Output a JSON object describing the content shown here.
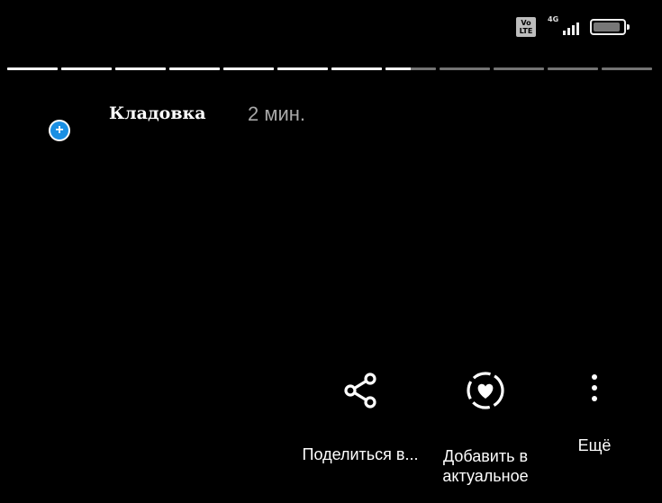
{
  "status_bar": {
    "volte_label": "Vo\nLTE",
    "network_label": "4G",
    "signal_bars": 4,
    "battery_level": 0.9
  },
  "story": {
    "segments_total": 12,
    "segments_seen": 7,
    "current_segment_progress": 0.5
  },
  "header": {
    "username": "Кладовка",
    "timestamp": "2 мин."
  },
  "actions": {
    "share_label": "Поделиться в...",
    "highlight_label": "Добавить в актуальное",
    "more_label": "Ещё"
  },
  "colors": {
    "background": "#000000",
    "add_badge": "#1a8fe3",
    "timestamp": "#a8a8a8"
  }
}
